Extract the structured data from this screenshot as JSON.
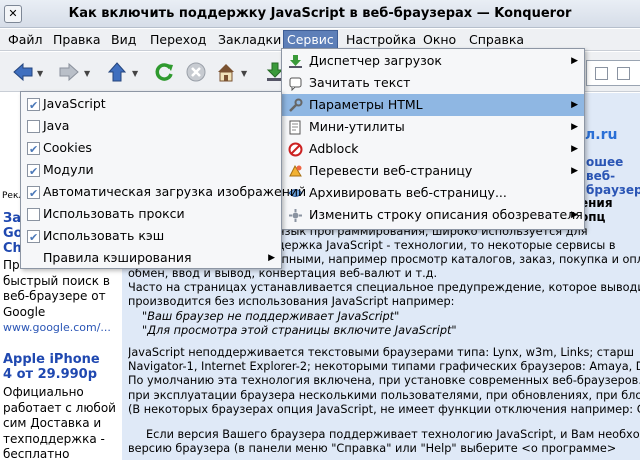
{
  "window": {
    "title": "Как включить поддержку JavaScript в веб-браузерах — Konqueror"
  },
  "menubar": [
    {
      "label": "Файл"
    },
    {
      "label": "Правка"
    },
    {
      "label": "Вид"
    },
    {
      "label": "Переход"
    },
    {
      "label": "Закладки"
    },
    {
      "label": "Сервис",
      "active": true
    },
    {
      "label": "Настройка"
    },
    {
      "label": "Окно"
    },
    {
      "label": "Справка"
    }
  ],
  "toolbar": {
    "icons": [
      "back-icon",
      "forward-icon",
      "up-icon",
      "reload-icon",
      "stop-icon",
      "home-icon",
      "download-icon"
    ]
  },
  "service_menu": {
    "items": [
      {
        "label": "Диспетчер загрузок",
        "icon": "download-manager-icon",
        "submenu": true
      },
      {
        "label": "Зачитать текст",
        "icon": "speech-icon",
        "submenu": false
      },
      {
        "label": "Параметры HTML",
        "icon": "wrench-icon",
        "submenu": true,
        "highlighted": true
      },
      {
        "label": "Мини-утилиты",
        "icon": "applets-icon",
        "submenu": true
      },
      {
        "label": "Adblock",
        "icon": "adblock-icon",
        "submenu": true
      },
      {
        "label": "Перевести веб-страницу",
        "icon": "translate-icon",
        "submenu": true
      },
      {
        "label": "Архивировать веб-страницу...",
        "icon": "archive-icon",
        "submenu": false
      },
      {
        "label": "Изменить строку описания обозревателя",
        "icon": "useragent-icon",
        "submenu": true
      }
    ]
  },
  "html_settings_menu": {
    "items": [
      {
        "label": "JavaScript",
        "checked": true
      },
      {
        "label": "Java",
        "checked": false
      },
      {
        "label": "Cookies",
        "checked": true
      },
      {
        "label": "Модули",
        "checked": true
      },
      {
        "label": "Автоматическая загрузка изображений",
        "checked": true
      },
      {
        "label": "Использовать прокси",
        "checked": false
      },
      {
        "label": "Использовать кэш",
        "checked": true
      },
      {
        "label": "Правила кэширования",
        "checked": null,
        "submenu": true
      }
    ]
  },
  "page": {
    "sidebar": {
      "label_reklama": "Рекл",
      "ad1_title": [
        "Зап",
        "Goo",
        "Ch"
      ],
      "ad1_text": [
        "Простой и",
        "быстрый поиск в",
        "веб-браузере от",
        "Google"
      ],
      "ad1_url": "www.google.com/...",
      "ad2_title": [
        "Apple iPhone",
        "4 от 29.990р"
      ],
      "ad2_text": [
        "Официально",
        "работает с любой",
        "сим Доставка и",
        "техподдержка -",
        "бесплатно"
      ]
    },
    "main": {
      "logo_fragment": "л.ru",
      "link1": "ошее",
      "link2": "веб-браузер",
      "heading_fragment": "ения опц",
      "paragraph1": [
        ") - язык программирования, широко используется для",
        "оддержка JavaScript - технологии, то некоторые сервисы в",
        "ступными, например просмотр каталогов, заказ, покупка и опл",
        "обмен, ввод и вывод, конвертация веб-валют и т.д.",
        "Часто на страницах устанавливается специальное предупреждение, которое выводи",
        "производится без использования JavaScript например:"
      ],
      "quote1": "\"Ваш браузер не поддерживает JavaScript\"",
      "quote2": "\"Для просмотра этой страницы включите JavaScript\"",
      "paragraph2": [
        "JavaScript неподдерживается текстовыми браузерами типа: Lynx, w3m, Links; старш",
        "Navigator-1, Internet Explorer-2; некоторыми типами графических браузеров: Amaya, D",
        "По умолчанию эта технология включена, при установке современных веб-браузеров.",
        "при эксплуатации браузера несколькими пользователями, при обновлениях, при блок",
        "(В некоторых браузерах опция JavaScript, не имеет функции отключения например: Go"
      ],
      "paragraph3": [
        "Если версия Вашего браузера поддерживает технологию JavaScript, и Вам необхо",
        "версию браузера (в панели меню \"Справка\" или \"Help\" выберите <о программе>"
      ]
    }
  },
  "colors": {
    "accent": "#5d7fb8",
    "menu_highlight": "#8fb7e3",
    "page_bg": "#dfe9f7"
  }
}
